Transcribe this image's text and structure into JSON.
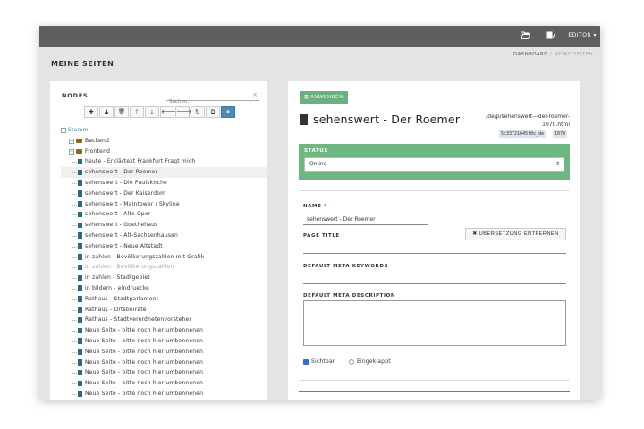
{
  "topbar": {
    "folder_icon": "folder-open-icon",
    "book_icon": "book-edit-icon",
    "editor_label": "EDITOR ▾"
  },
  "page": {
    "title": "MEINE SEITEN",
    "breadcrumb": {
      "home": "DASHBOARD",
      "separator": "/",
      "current": "MEINE SEITEN"
    }
  },
  "nodes_panel": {
    "label": "NODES",
    "search_placeholder": "Suchen...",
    "toolbar": [
      {
        "name": "add-icon",
        "glyph": "✚"
      },
      {
        "name": "person-icon",
        "glyph": "♟"
      },
      {
        "name": "trash-icon",
        "glyph": "🗑"
      },
      {
        "name": "arrow-up-icon",
        "glyph": "🡑"
      },
      {
        "name": "arrow-down-icon",
        "glyph": "🡓"
      },
      {
        "name": "arrow-left-icon",
        "glyph": "🡐"
      },
      {
        "name": "arrow-right-icon",
        "glyph": "🡒"
      },
      {
        "name": "refresh-icon",
        "glyph": "↻"
      },
      {
        "name": "copy-icon",
        "glyph": "⧉"
      },
      {
        "name": "share-icon",
        "glyph": "⚭"
      }
    ],
    "tree": {
      "root": "Stamm",
      "backend": "Backend",
      "frontend": "Frontend",
      "items": [
        "heute - Erklärtext Frankfurt Fragt mich",
        "sehenswert - Der Roemer",
        "sehenswert - Die Paulskirche",
        "sehenswert - Der Kaiserdom",
        "sehenswert - Maintower / Skyline",
        "sehenswert - Alte Oper",
        "sehenswert - Goethehaus",
        "sehenswert - Alt-Sachsenhausen",
        "sehenswert - Neue Altstadt",
        "in zahlen - Bevölkerungszahlen mit Grafik",
        "in zahlen - Bevölkerungszahlen",
        "in zahlen - Stadtgebiet",
        "in bildern - eindruecke",
        "Rathaus - Stadtparlament",
        "Rathaus - Ortsbeiräte",
        "Rathaus - Stadtverordnetenvorsteher",
        "Neue Seite - bitte noch hier umbennenen",
        "Neue Seite - bitte noch hier umbennenen",
        "Neue Seite - bitte noch hier umbennenen",
        "Neue Seite - bitte noch hier umbennenen",
        "Neue Seite - bitte noch hier umbennenen",
        "Neue Seite - bitte noch hier umbennenen",
        "Neue Seite - bitte noch hier umbennenen"
      ]
    }
  },
  "editor": {
    "apply_label": "ANWENDEN",
    "doc_title": "sehenswert - Der Roemer",
    "path": "/de/p/sehenswert---der-roemer-1070.html",
    "id_tag": "5c33721b45f0c_de",
    "num_tag": "1070",
    "status_label": "STATUS",
    "status_value": "Online",
    "name_label": "NAME",
    "required_mark": "*",
    "name_value": "sehenswert - Der Roemer",
    "remove_translation": "ÜBERSETZUNG ENTFERNEN",
    "page_title_label": "PAGE TITLE",
    "meta_keywords_label": "DEFAULT META KEYWORDS",
    "meta_description_label": "DEFAULT META DESCRIPTION",
    "visible_label": "Sichtbar",
    "collapsed_label": "Eingeklappt"
  }
}
